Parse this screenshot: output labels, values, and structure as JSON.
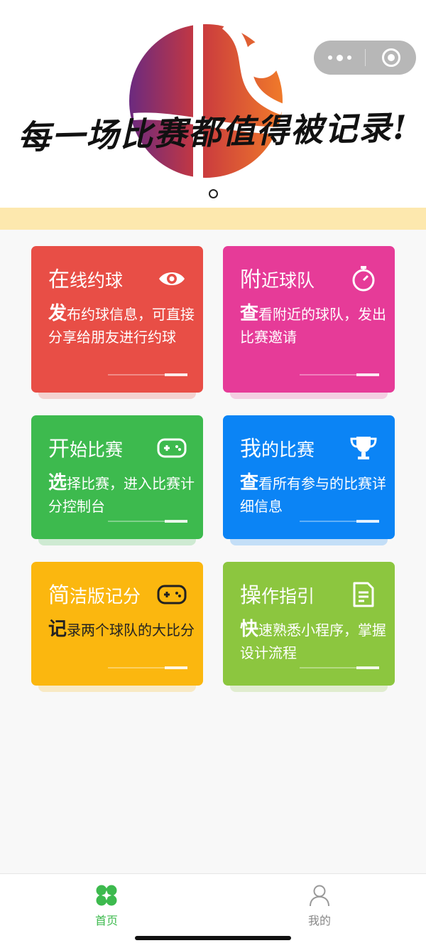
{
  "banner": {
    "slogan": "每一场比赛都值得被记录!",
    "page_count": 1,
    "active_index": 0
  },
  "capsule": {
    "more_icon": "more-dots-icon",
    "close_icon": "mini-program-close-icon"
  },
  "cards": [
    {
      "title_first": "在",
      "title_rest": "线约球",
      "desc_first": "发",
      "desc_rest": "布约球信息，可直接分享给朋友进行约球",
      "icon": "eye-icon",
      "color": "#e84e46"
    },
    {
      "title_first": "附",
      "title_rest": "近球队",
      "desc_first": "查",
      "desc_rest": "看附近的球队，发出比赛邀请",
      "icon": "stopwatch-icon",
      "color": "#e63b98"
    },
    {
      "title_first": "开",
      "title_rest": "始比赛",
      "desc_first": "选",
      "desc_rest": "择比赛，进入比赛计分控制台",
      "icon": "gamepad-icon",
      "color": "#3dba4e"
    },
    {
      "title_first": "我",
      "title_rest": "的比赛",
      "desc_first": "查",
      "desc_rest": "看所有参与的比赛详细信息",
      "icon": "trophy-icon",
      "color": "#0b84f5"
    },
    {
      "title_first": "简",
      "title_rest": "洁版记分",
      "desc_first": "记",
      "desc_rest": "录两个球队的大比分",
      "icon": "gamepad-icon",
      "color": "#fbb70f"
    },
    {
      "title_first": "操",
      "title_rest": "作指引",
      "desc_first": "快",
      "desc_rest": "速熟悉小程序，掌握设计流程",
      "icon": "document-icon",
      "color": "#8cc63f"
    }
  ],
  "tabbar": {
    "items": [
      {
        "label": "首页",
        "icon": "home-clover-icon",
        "active": true
      },
      {
        "label": "我的",
        "icon": "user-icon",
        "active": false
      }
    ],
    "active_color": "#3dba4e",
    "inactive_color": "#888888"
  }
}
